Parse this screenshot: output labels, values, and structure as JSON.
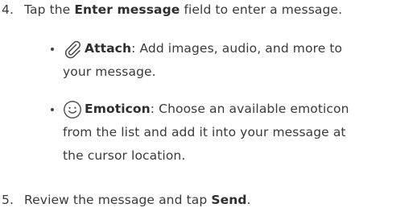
{
  "steps": [
    {
      "number": "4.",
      "pre": "Tap the ",
      "bold": "Enter message",
      "post": " field to enter a message."
    },
    {
      "number": "5.",
      "pre": "Review the message and tap ",
      "bold": "Send",
      "post": "."
    }
  ],
  "bullets": [
    {
      "icon": "paperclip-icon",
      "bold": "Attach",
      "lines": [
        ": Add images, audio, and more to",
        "your message."
      ]
    },
    {
      "icon": "smiley-icon",
      "bold": "Emoticon",
      "lines": [
        ": Choose an available emoticon",
        "from the list and add it into your message at",
        "the cursor location."
      ]
    }
  ]
}
